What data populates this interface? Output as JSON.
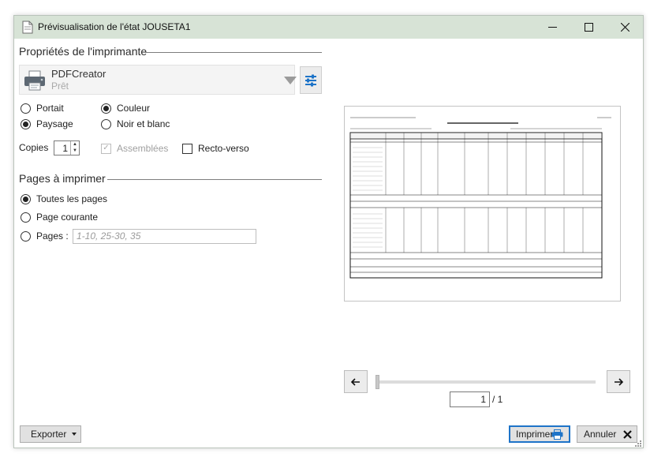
{
  "window": {
    "title": "Prévisualisation de l'état JOUSETA1",
    "controls": {
      "minimize_icon": "minimize-icon",
      "maximize_icon": "maximize-icon",
      "close_icon": "close-icon"
    }
  },
  "printer_properties": {
    "section_title": "Propriétés de l'imprimante",
    "printer_name": "PDFCreator",
    "printer_status": "Prêt",
    "orientation": {
      "portrait": "Portait",
      "landscape": "Paysage",
      "selected": "Paysage"
    },
    "color_mode": {
      "color": "Couleur",
      "bw": "Noir et blanc",
      "selected": "Couleur"
    },
    "copies_label": "Copies",
    "copies_value": "1",
    "collated_label": "Assemblées",
    "collated_checked": true,
    "collated_enabled": false,
    "duplex_label": "Recto-verso",
    "duplex_checked": false
  },
  "pages_to_print": {
    "section_title": "Pages à imprimer",
    "all_pages": "Toutes les pages",
    "current_page": "Page courante",
    "pages_label": "Pages :",
    "pages_placeholder": "1-10, 25-30, 35",
    "selected": "Toutes les pages"
  },
  "navigation": {
    "current_page": "1",
    "total_pages": "/ 1"
  },
  "footer": {
    "export_label": "Exporter",
    "print_label": "Imprimer",
    "cancel_label": "Annuler"
  },
  "colors": {
    "titlebar": "#d7e3d6",
    "accent": "#1e74c8"
  }
}
